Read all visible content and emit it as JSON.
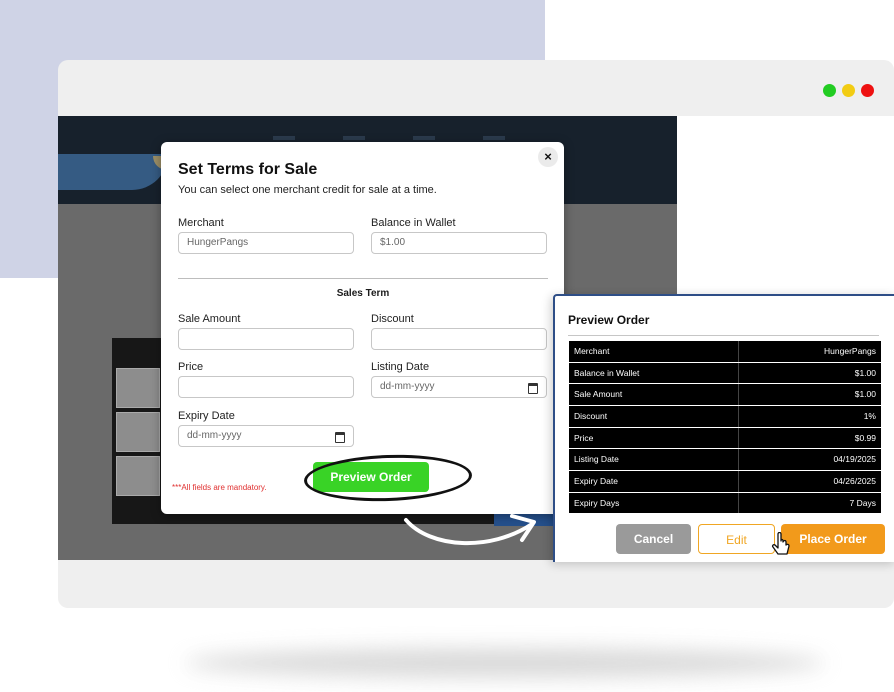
{
  "window": {
    "dots": [
      {
        "name": "green",
        "color": "#22cc22"
      },
      {
        "name": "yellow",
        "color": "#f2cc13"
      },
      {
        "name": "red",
        "color": "#ee1111"
      }
    ]
  },
  "modal": {
    "title": "Set Terms for Sale",
    "subtitle": "You can select one merchant credit for sale at a time.",
    "close_label": "×",
    "merchant": {
      "label": "Merchant",
      "value": "HungerPangs"
    },
    "balance": {
      "label": "Balance in Wallet",
      "value": "$1.00"
    },
    "section_title": "Sales Term",
    "sale_amount": {
      "label": "Sale Amount",
      "value": ""
    },
    "discount": {
      "label": "Discount",
      "value": ""
    },
    "price": {
      "label": "Price",
      "value": ""
    },
    "listing_date": {
      "label": "Listing Date",
      "placeholder": "dd-mm-yyyy"
    },
    "expiry_date": {
      "label": "Expiry Date",
      "placeholder": "dd-mm-yyyy"
    },
    "mandatory_note": "***All fields are mandatory.",
    "preview_button": "Preview Order"
  },
  "preview": {
    "title": "Preview Order",
    "rows": [
      {
        "label": "Merchant",
        "value": "HungerPangs"
      },
      {
        "label": "Balance in Wallet",
        "value": "$1.00"
      },
      {
        "label": "Sale Amount",
        "value": "$1.00"
      },
      {
        "label": "Discount",
        "value": "1%"
      },
      {
        "label": "Price",
        "value": "$0.99"
      },
      {
        "label": "Listing Date",
        "value": "04/19/2025"
      },
      {
        "label": "Expiry Date",
        "value": "04/26/2025"
      },
      {
        "label": "Expiry Days",
        "value": "7 Days"
      }
    ],
    "cancel": "Cancel",
    "edit": "Edit",
    "place_order": "Place Order"
  },
  "colors": {
    "accent_green": "#39d326",
    "accent_orange": "#f29a1b",
    "mandatory_red": "#e03030"
  },
  "icons": [
    "close-icon",
    "calendar-icon",
    "cursor-pointer-icon",
    "curved-arrow-icon"
  ]
}
